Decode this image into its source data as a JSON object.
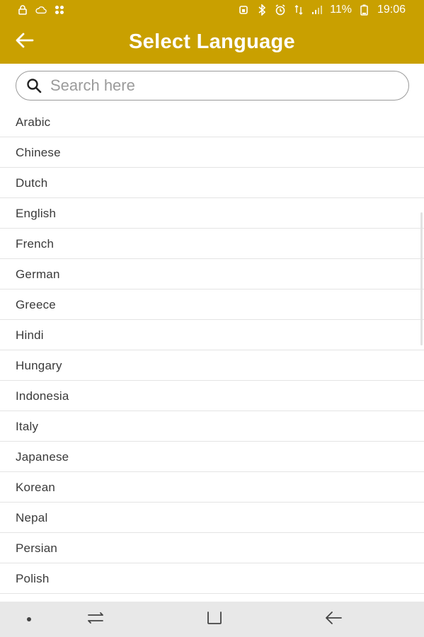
{
  "status_bar": {
    "battery": "11%",
    "time": "19:06",
    "left_icons": [
      "lock-icon",
      "cloud-icon",
      "apps-icon"
    ],
    "right_icons": [
      "alarm-lock-icon",
      "bluetooth-icon",
      "alarm-icon",
      "data-icon",
      "signal-icon",
      "battery-icon"
    ]
  },
  "header": {
    "title": "Select Language",
    "back_icon": "back-arrow-icon"
  },
  "search": {
    "placeholder": "Search here",
    "value": ""
  },
  "languages": [
    "Arabic",
    "Chinese",
    "Dutch",
    "English",
    "French",
    "German",
    "Greece",
    "Hindi",
    "Hungary",
    "Indonesia",
    "Italy",
    "Japanese",
    "Korean",
    "Nepal",
    "Persian",
    "Polish"
  ],
  "navigation": {
    "items": [
      "dot-icon",
      "recent-apps-icon",
      "home-icon",
      "back-icon"
    ]
  },
  "colors": {
    "accent": "#c9a000",
    "nav_background": "#e8e8e8",
    "divider": "#e4e4e4"
  }
}
